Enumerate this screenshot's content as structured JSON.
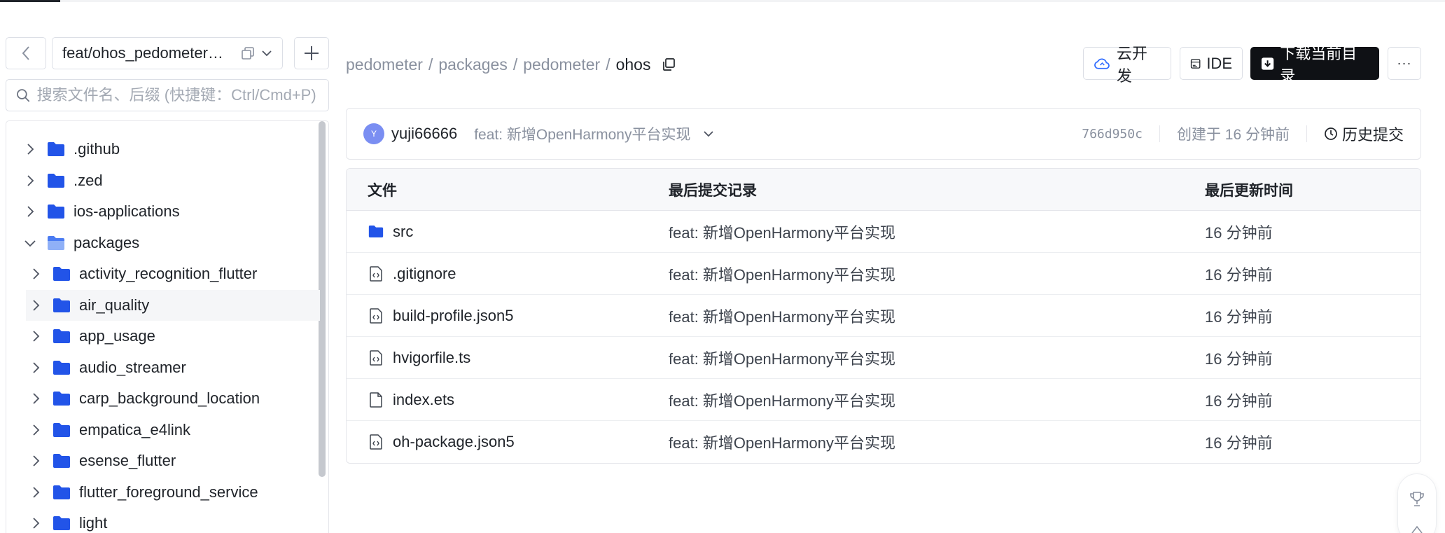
{
  "sidebar": {
    "branch": "feat/ohos_pedometer…",
    "search_placeholder": "搜索文件名、后缀 (快捷键：Ctrl/Cmd+P)",
    "tree": [
      {
        "label": ".github",
        "expanded": false,
        "level": 0
      },
      {
        "label": ".zed",
        "expanded": false,
        "level": 0
      },
      {
        "label": "ios-applications",
        "expanded": false,
        "level": 0
      },
      {
        "label": "packages",
        "expanded": true,
        "level": 0
      },
      {
        "label": "activity_recognition_flutter",
        "expanded": false,
        "level": 1
      },
      {
        "label": "air_quality",
        "expanded": false,
        "level": 1
      },
      {
        "label": "app_usage",
        "expanded": false,
        "level": 1
      },
      {
        "label": "audio_streamer",
        "expanded": false,
        "level": 1
      },
      {
        "label": "carp_background_location",
        "expanded": false,
        "level": 1
      },
      {
        "label": "empatica_e4link",
        "expanded": false,
        "level": 1
      },
      {
        "label": "esense_flutter",
        "expanded": false,
        "level": 1
      },
      {
        "label": "flutter_foreground_service",
        "expanded": false,
        "level": 1
      },
      {
        "label": "light",
        "expanded": false,
        "level": 1
      }
    ]
  },
  "breadcrumb": {
    "items": [
      "pedometer",
      "packages",
      "pedometer"
    ],
    "separator": "/",
    "current": "ohos"
  },
  "toolbar": {
    "cloud_label": "云开发",
    "ide_label": "IDE",
    "download_label": "下载当前目录",
    "more_label": "···"
  },
  "commit": {
    "avatar_letter": "Y",
    "author": "yuji66666",
    "message": "feat: 新增OpenHarmony平台实现",
    "hash": "766d950c",
    "created": "创建于 16 分钟前",
    "history_label": "历史提交"
  },
  "files": {
    "headers": {
      "file": "文件",
      "last_commit": "最后提交记录",
      "updated": "最后更新时间"
    },
    "rows": [
      {
        "name": "src",
        "icon": "folder-icon",
        "message": "feat: 新增OpenHarmony平台实现",
        "time": "16 分钟前"
      },
      {
        "name": ".gitignore",
        "icon": "code-file-icon",
        "message": "feat: 新增OpenHarmony平台实现",
        "time": "16 分钟前"
      },
      {
        "name": "build-profile.json5",
        "icon": "code-file-icon",
        "message": "feat: 新增OpenHarmony平台实现",
        "time": "16 分钟前"
      },
      {
        "name": "hvigorfile.ts",
        "icon": "code-file-icon",
        "message": "feat: 新增OpenHarmony平台实现",
        "time": "16 分钟前"
      },
      {
        "name": "index.ets",
        "icon": "file-icon",
        "message": "feat: 新增OpenHarmony平台实现",
        "time": "16 分钟前"
      },
      {
        "name": "oh-package.json5",
        "icon": "code-file-icon",
        "message": "feat: 新增OpenHarmony平台实现",
        "time": "16 分钟前"
      }
    ]
  },
  "colors": {
    "accent_folder": "#2254e8",
    "dark_button": "#0f1115",
    "avatar": "#7a8ef2"
  }
}
